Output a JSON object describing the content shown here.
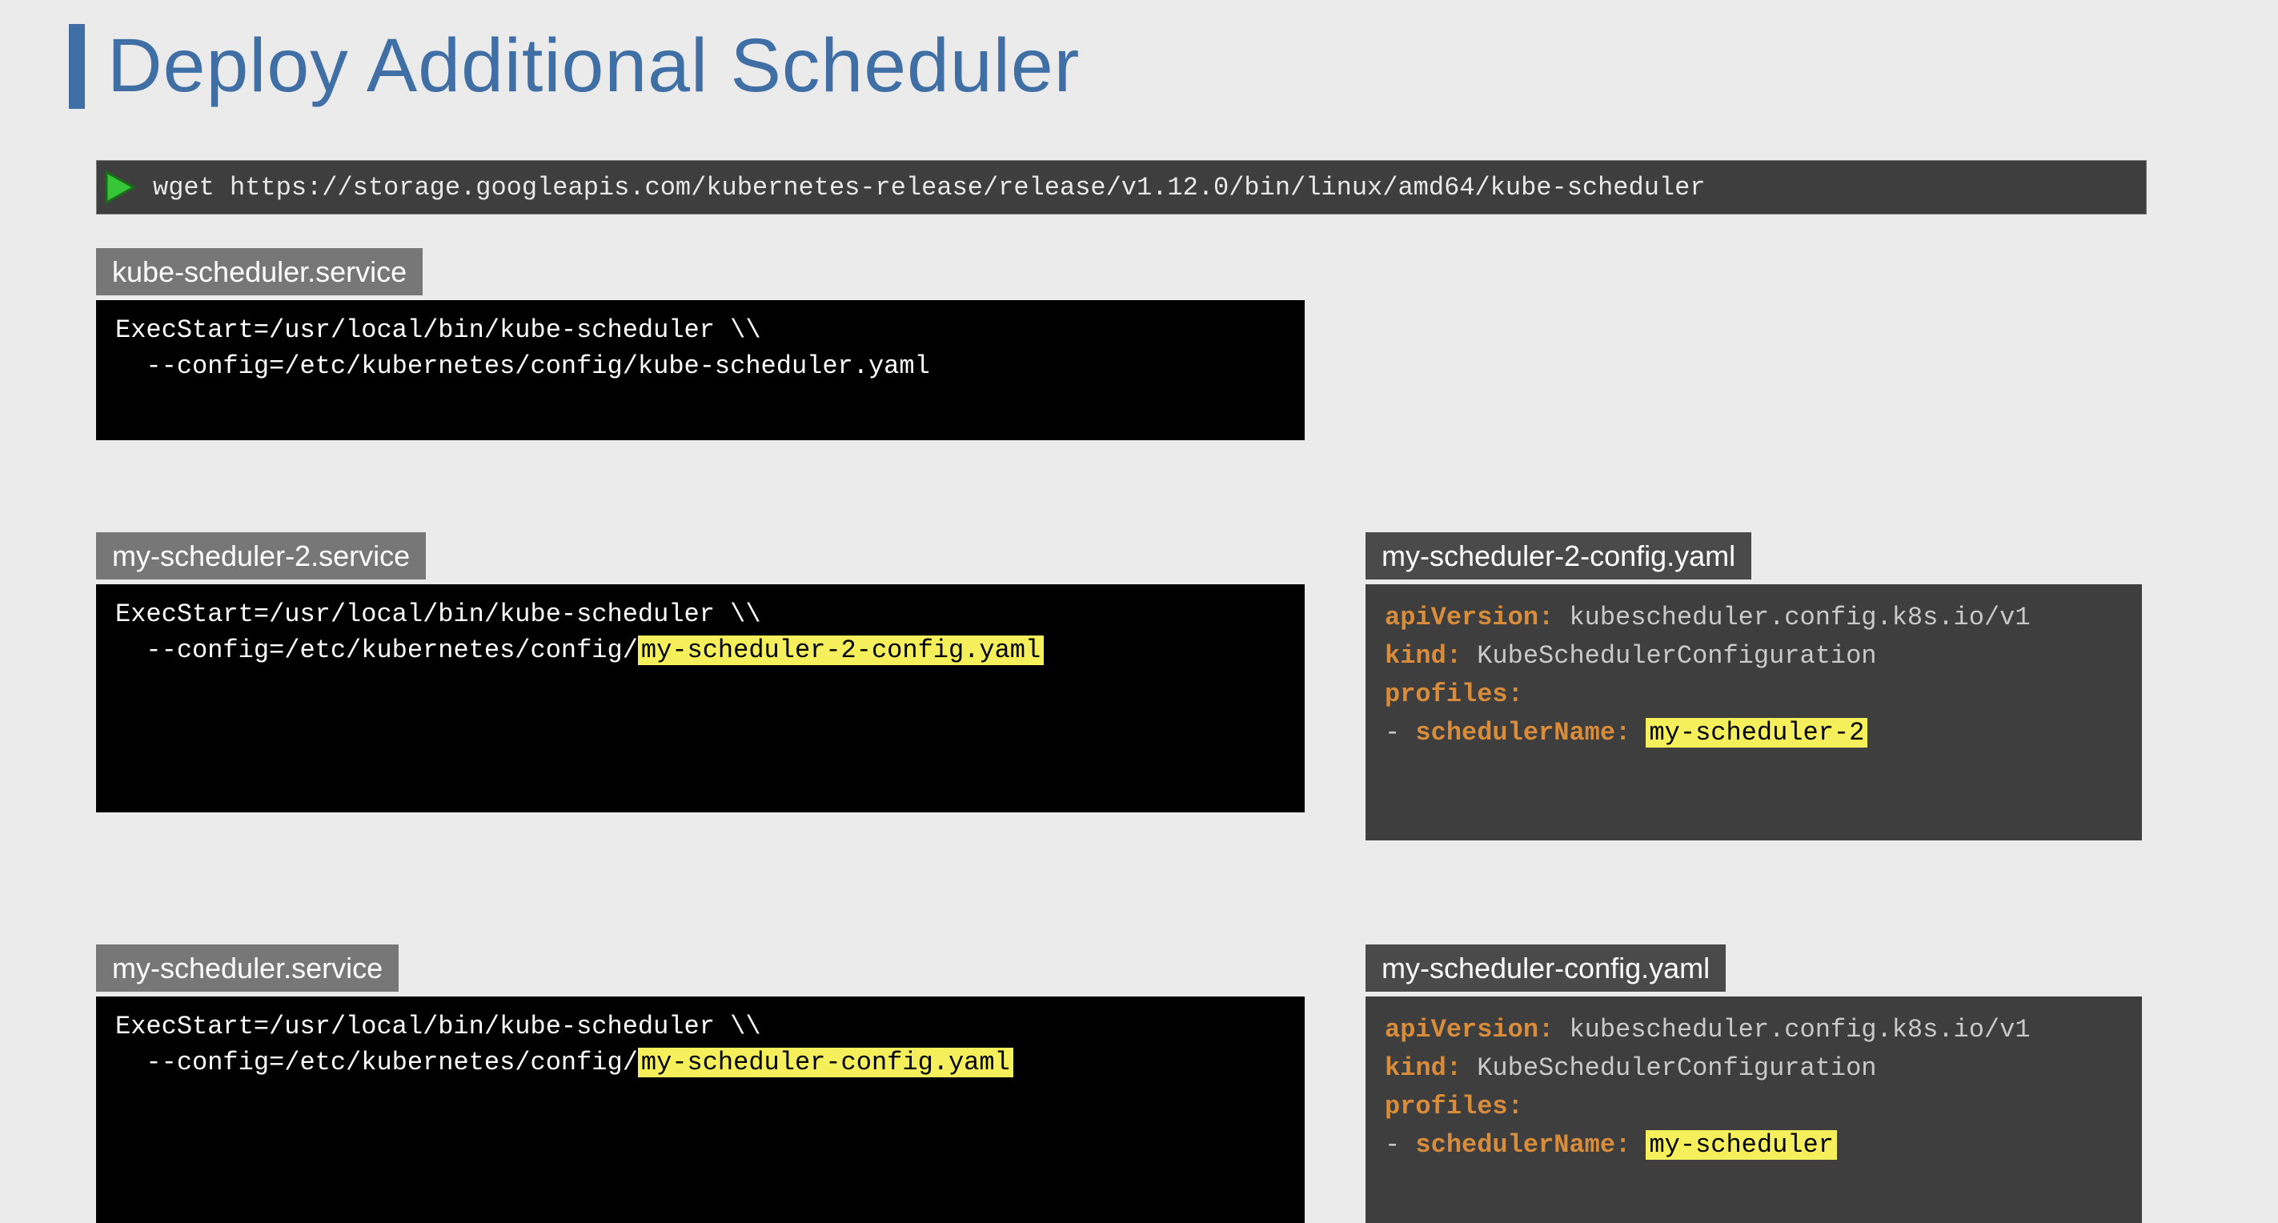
{
  "title": "Deploy Additional Scheduler",
  "wget_cmd": "wget https://storage.googleapis.com/kubernetes-release/release/v1.12.0/bin/linux/amd64/kube-scheduler",
  "kube_service": {
    "tab": "kube-scheduler.service",
    "line1": "ExecStart=/usr/local/bin/kube-scheduler \\\\",
    "line2": "  --config=/etc/kubernetes/config/kube-scheduler.yaml"
  },
  "mysched2_service": {
    "tab": "my-scheduler-2.service",
    "line1": "ExecStart=/usr/local/bin/kube-scheduler \\\\",
    "line2_prefix": "  --config=/etc/kubernetes/config/",
    "line2_hl": "my-scheduler-2-config.yaml"
  },
  "mysched_service": {
    "tab": "my-scheduler.service",
    "line1": "ExecStart=/usr/local/bin/kube-scheduler \\\\",
    "line2_prefix": "  --config=/etc/kubernetes/config/",
    "line2_hl": "my-scheduler-config.yaml"
  },
  "cfg2": {
    "tab": "my-scheduler-2-config.yaml",
    "k_apiVersion": "apiVersion:",
    "v_apiVersion": " kubescheduler.config.k8s.io/v1",
    "k_kind": "kind:",
    "v_kind": " KubeSchedulerConfiguration",
    "k_profiles": "profiles:",
    "dash": "- ",
    "k_schedulerName": "schedulerName:",
    "v_schedulerName": "my-scheduler-2"
  },
  "cfg": {
    "tab": "my-scheduler-config.yaml",
    "k_apiVersion": "apiVersion:",
    "v_apiVersion": " kubescheduler.config.k8s.io/v1",
    "k_kind": "kind:",
    "v_kind": " KubeSchedulerConfiguration",
    "k_profiles": "profiles:",
    "dash": "- ",
    "k_schedulerName": "schedulerName:",
    "v_schedulerName": "my-scheduler"
  }
}
